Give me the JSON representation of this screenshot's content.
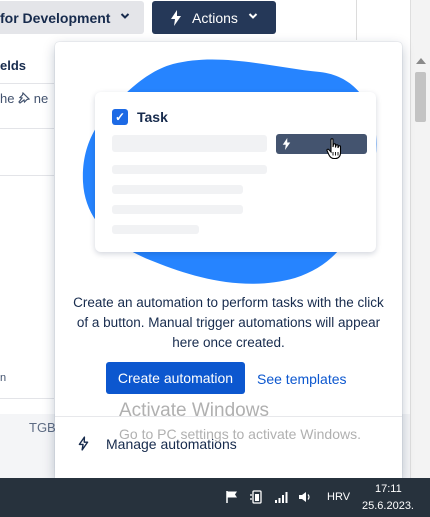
{
  "header": {
    "dev_select_label": "for Development",
    "actions_label": "Actions"
  },
  "left_panel": {
    "fields_label": "elds",
    "pin_row_text": "he",
    "pin_row_suffix": "ne",
    "bottom_label": "n",
    "footer_label": "TGB"
  },
  "popup": {
    "card_title": "Task",
    "description": "Create an automation to perform tasks with the click of a button. Manual trigger automations will appear here once created.",
    "create_button": "Create automation",
    "templates_link": "See templates",
    "manage_label": "Manage automations"
  },
  "watermark": {
    "title": "Activate Windows",
    "subtitle": "Go to PC settings to activate Windows."
  },
  "taskbar": {
    "language": "HRV",
    "time": "17:11",
    "date": "25.6.2023."
  },
  "colors": {
    "primary": "#0c57cf",
    "header_dark": "#253858",
    "blob": "#2684ff",
    "taskbar": "#27323d"
  },
  "icons": [
    "chevron-down-icon",
    "lightning-bolt-icon",
    "pin-icon",
    "checkbox-icon",
    "hand-cursor-icon",
    "flag-icon",
    "battery-icon",
    "signal-icon",
    "speaker-icon"
  ]
}
